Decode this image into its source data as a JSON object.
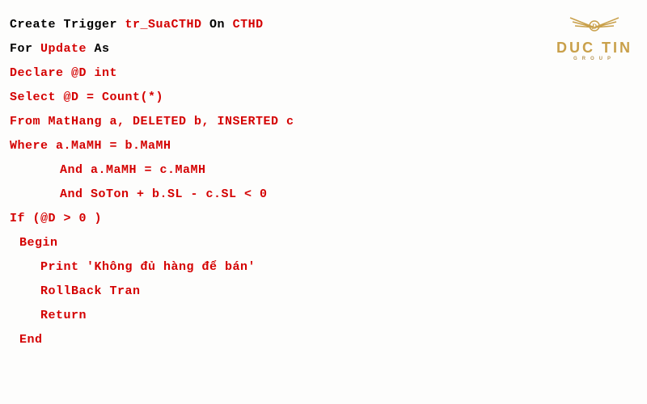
{
  "logo": {
    "brand": "DUC TIN",
    "subtitle": "GROUP"
  },
  "code": {
    "l1": {
      "a": "Create Trigger ",
      "b": "tr_SuaCTHD",
      "c": " On ",
      "d": "CTHD"
    },
    "l2": {
      "a": "For ",
      "b": "Update",
      "c": " As"
    },
    "l3": "Declare @D int",
    "l4": "Select @D = Count(*)",
    "l5": "From MatHang a, DELETED b, INSERTED c",
    "l6": "Where a.MaMH = b.MaMH",
    "l7": "And a.MaMH = c.MaMH",
    "l8": "And SoTon + b.SL - c.SL < 0",
    "l9": "If (@D > 0 )",
    "l10": "Begin",
    "l11": "Print 'Không đủ hàng để bán'",
    "l12": "RollBack Tran",
    "l13": "Return",
    "l14": "End"
  }
}
